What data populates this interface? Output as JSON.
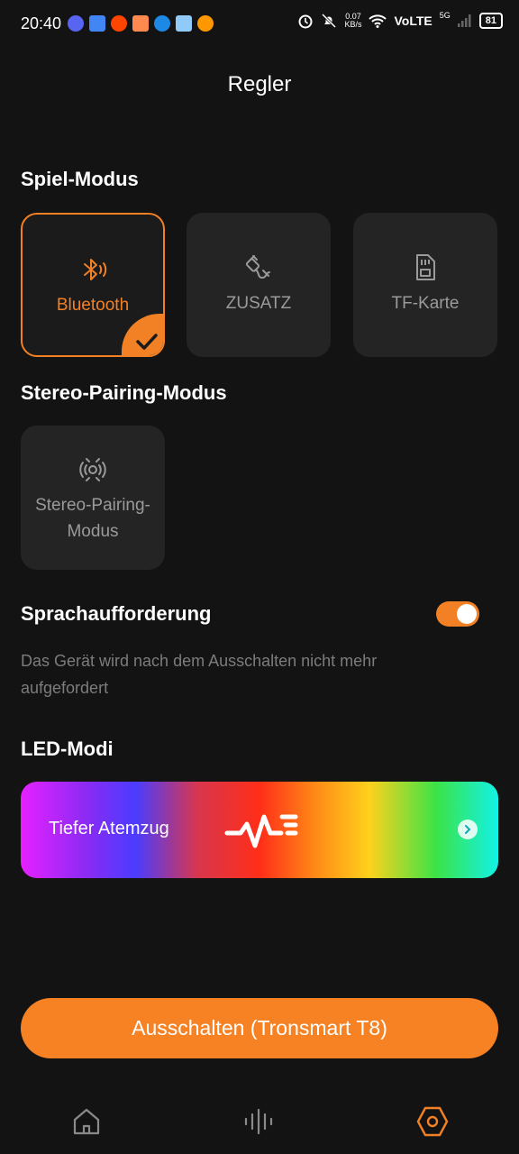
{
  "status_bar": {
    "time": "20:40",
    "net_speed_value": "0.07",
    "net_speed_unit": "KB/s",
    "network": "VoLTE",
    "network_gen": "5G",
    "battery": "81"
  },
  "page": {
    "title": "Regler"
  },
  "game_mode": {
    "title": "Spiel-Modus",
    "options": [
      {
        "label": "Bluetooth",
        "icon": "bluetooth-icon",
        "selected": true
      },
      {
        "label": "ZUSATZ",
        "icon": "aux-cable-icon",
        "selected": false
      },
      {
        "label": "TF-Karte",
        "icon": "sd-card-icon",
        "selected": false
      }
    ]
  },
  "stereo_pairing": {
    "title": "Stereo-Pairing-Modus",
    "card_label_line1": "Stereo-Pairing-",
    "card_label_line2": "Modus",
    "icon": "stereo-pairing-icon"
  },
  "voice_prompt": {
    "title": "Sprachaufforderung",
    "enabled": true,
    "hint": "Das Gerät wird nach dem Ausschalten nicht mehr aufgefordert"
  },
  "led": {
    "title": "LED-Modi",
    "current_mode": "Tiefer Atemzug"
  },
  "power": {
    "button_label": "Ausschalten (Tronsmart T8)"
  },
  "bottom_nav": [
    {
      "name": "home",
      "icon": "home-icon",
      "active": false
    },
    {
      "name": "equalizer",
      "icon": "sound-wave-icon",
      "active": false
    },
    {
      "name": "settings",
      "icon": "hexagon-settings-icon",
      "active": true
    }
  ],
  "colors": {
    "accent": "#f28125",
    "background": "#131313",
    "card": "#242424"
  }
}
